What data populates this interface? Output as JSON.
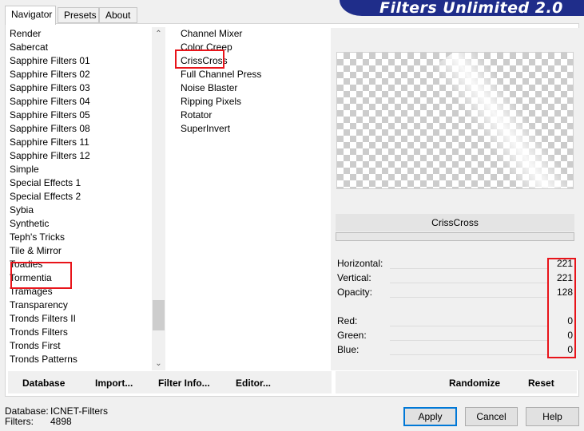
{
  "app_title": "Filters Unlimited 2.0",
  "tabs": [
    {
      "label": "Navigator"
    },
    {
      "label": "Presets"
    },
    {
      "label": "About"
    }
  ],
  "categories": [
    "Render",
    "Sabercat",
    "Sapphire Filters 01",
    "Sapphire Filters 02",
    "Sapphire Filters 03",
    "Sapphire Filters 04",
    "Sapphire Filters 05",
    "Sapphire Filters 08",
    "Sapphire Filters 11",
    "Sapphire Filters 12",
    "Simple",
    "Special Effects 1",
    "Special Effects 2",
    "Sybia",
    "Synthetic",
    "Teph's Tricks",
    "Tile & Mirror",
    "Toadies",
    "Tormentia",
    "Tramages",
    "Transparency",
    "Tronds Filters II",
    "Tronds Filters",
    "Tronds First",
    "Tronds Patterns"
  ],
  "selected_category": "Tormentia",
  "filters": [
    "Channel Mixer",
    "Color Creep",
    "CrissCross",
    "Full Channel Press",
    "Noise Blaster",
    "Ripping Pixels",
    "Rotator",
    "SuperInvert"
  ],
  "selected_filter": "CrissCross",
  "filter_name": "CrissCross",
  "params": [
    {
      "label": "Horizontal:",
      "value": "221"
    },
    {
      "label": "Vertical:",
      "value": "221"
    },
    {
      "label": "Opacity:",
      "value": "128"
    },
    {
      "label": "Red:",
      "value": "0"
    },
    {
      "label": "Green:",
      "value": "0"
    },
    {
      "label": "Blue:",
      "value": "0"
    }
  ],
  "toolbar": {
    "database": "Database",
    "import": "Import...",
    "filter_info": "Filter Info...",
    "editor": "Editor...",
    "randomize": "Randomize",
    "reset": "Reset"
  },
  "footer": {
    "database_label": "Database:",
    "database_value": "ICNET-Filters",
    "filters_label": "Filters:",
    "filters_value": "4898"
  },
  "buttons": {
    "apply": "Apply",
    "cancel": "Cancel",
    "help": "Help"
  },
  "colors": {
    "banner": "#1f2d8a",
    "highlight": "#e8141a",
    "default_button_border": "#0078d7"
  }
}
